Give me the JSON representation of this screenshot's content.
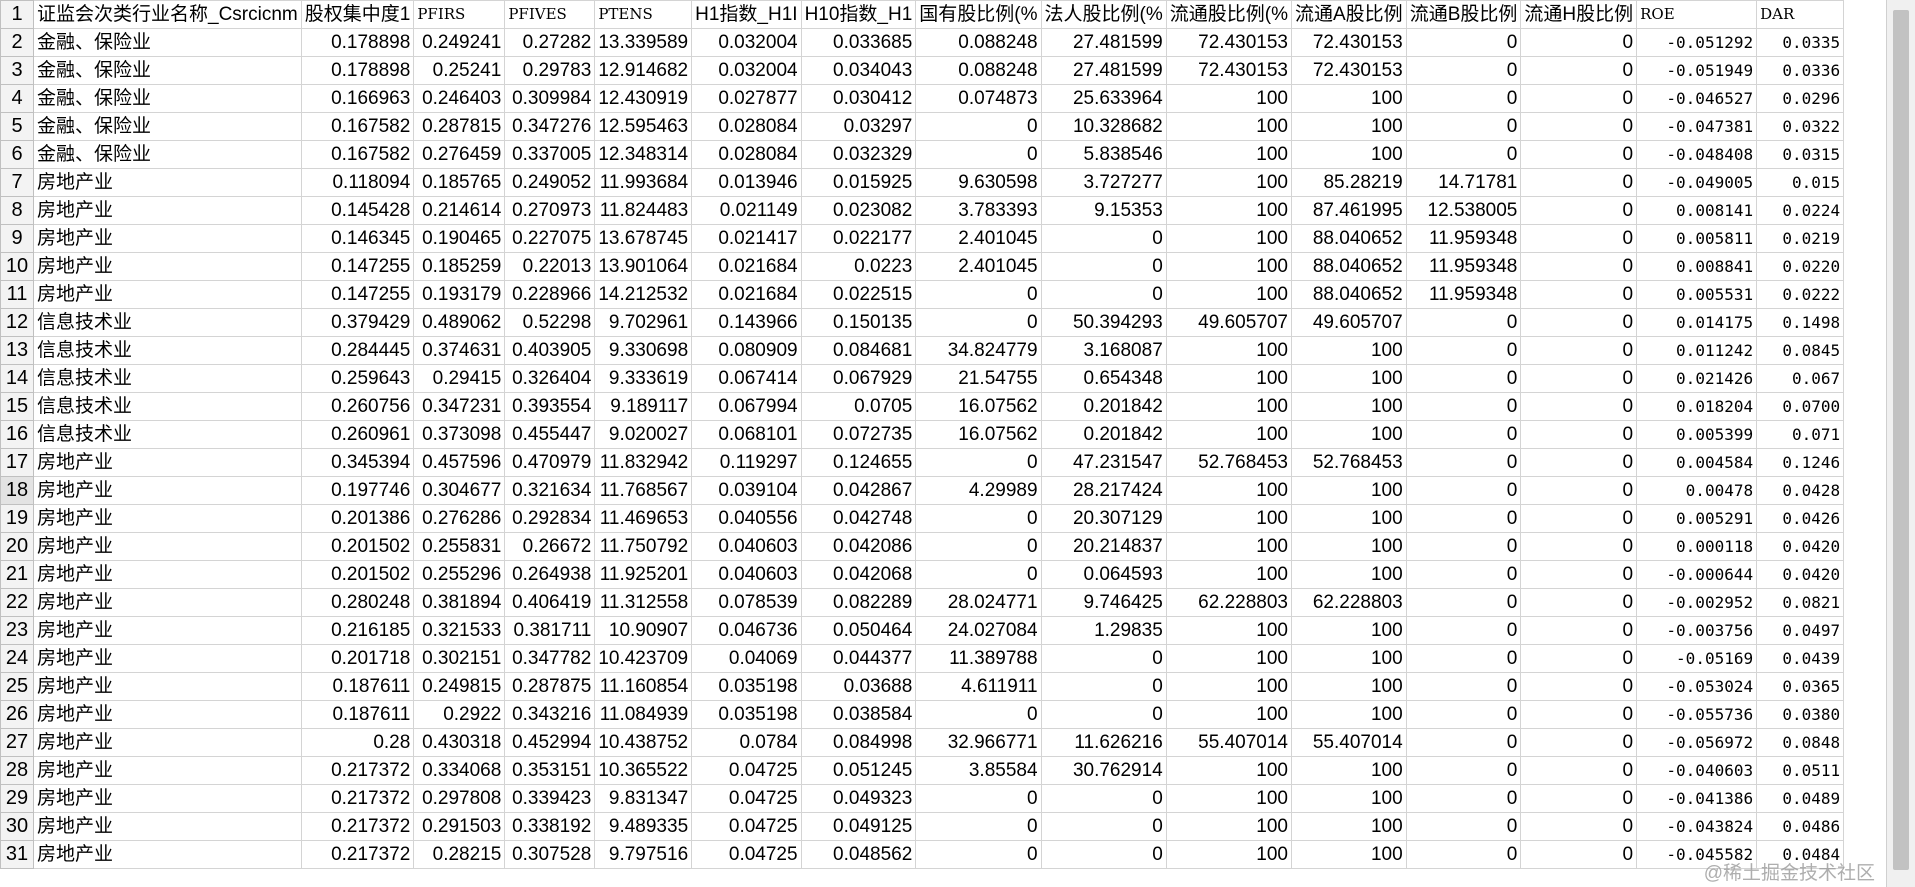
{
  "sheet": {
    "headers": [
      "证监会次类行业名称_Csrcicnm",
      "股权集中度1",
      "PFIRS",
      "PFIVES",
      "PTENS",
      "H1指数_H1I",
      "H10指数_H1",
      "国有股比例(%",
      "法人股比例(%",
      "流通股比例(%",
      "流通A股比例",
      "流通B股比例",
      "流通H股比例",
      "ROE",
      "DAR"
    ],
    "rows": [
      {
        "n": "2",
        "c": [
          "金融、保险业",
          "0.178898",
          "0.249241",
          "0.27282",
          "13.339589",
          "0.032004",
          "0.033685",
          "0.088248",
          "27.481599",
          "72.430153",
          "72.430153",
          "0",
          "0",
          "-0.051292",
          "0.0335"
        ]
      },
      {
        "n": "3",
        "c": [
          "金融、保险业",
          "0.178898",
          "0.25241",
          "0.29783",
          "12.914682",
          "0.032004",
          "0.034043",
          "0.088248",
          "27.481599",
          "72.430153",
          "72.430153",
          "0",
          "0",
          "-0.051949",
          "0.0336"
        ]
      },
      {
        "n": "4",
        "c": [
          "金融、保险业",
          "0.166963",
          "0.246403",
          "0.309984",
          "12.430919",
          "0.027877",
          "0.030412",
          "0.074873",
          "25.633964",
          "100",
          "100",
          "0",
          "0",
          "-0.046527",
          "0.0296"
        ]
      },
      {
        "n": "5",
        "c": [
          "金融、保险业",
          "0.167582",
          "0.287815",
          "0.347276",
          "12.595463",
          "0.028084",
          "0.03297",
          "0",
          "10.328682",
          "100",
          "100",
          "0",
          "0",
          "-0.047381",
          "0.0322"
        ]
      },
      {
        "n": "6",
        "c": [
          "金融、保险业",
          "0.167582",
          "0.276459",
          "0.337005",
          "12.348314",
          "0.028084",
          "0.032329",
          "0",
          "5.838546",
          "100",
          "100",
          "0",
          "0",
          "-0.048408",
          "0.0315"
        ]
      },
      {
        "n": "7",
        "c": [
          "房地产业",
          "0.118094",
          "0.185765",
          "0.249052",
          "11.993684",
          "0.013946",
          "0.015925",
          "9.630598",
          "3.727277",
          "100",
          "85.28219",
          "14.71781",
          "0",
          "-0.049005",
          "0.015"
        ]
      },
      {
        "n": "8",
        "c": [
          "房地产业",
          "0.145428",
          "0.214614",
          "0.270973",
          "11.824483",
          "0.021149",
          "0.023082",
          "3.783393",
          "9.15353",
          "100",
          "87.461995",
          "12.538005",
          "0",
          "0.008141",
          "0.0224"
        ]
      },
      {
        "n": "9",
        "c": [
          "房地产业",
          "0.146345",
          "0.190465",
          "0.227075",
          "13.678745",
          "0.021417",
          "0.022177",
          "2.401045",
          "0",
          "100",
          "88.040652",
          "11.959348",
          "0",
          "0.005811",
          "0.0219"
        ]
      },
      {
        "n": "10",
        "c": [
          "房地产业",
          "0.147255",
          "0.185259",
          "0.22013",
          "13.901064",
          "0.021684",
          "0.0223",
          "2.401045",
          "0",
          "100",
          "88.040652",
          "11.959348",
          "0",
          "0.008841",
          "0.0220"
        ]
      },
      {
        "n": "11",
        "c": [
          "房地产业",
          "0.147255",
          "0.193179",
          "0.228966",
          "14.212532",
          "0.021684",
          "0.022515",
          "0",
          "0",
          "100",
          "88.040652",
          "11.959348",
          "0",
          "0.005531",
          "0.0222"
        ]
      },
      {
        "n": "12",
        "c": [
          "信息技术业",
          "0.379429",
          "0.489062",
          "0.52298",
          "9.702961",
          "0.143966",
          "0.150135",
          "0",
          "50.394293",
          "49.605707",
          "49.605707",
          "0",
          "0",
          "0.014175",
          "0.1498"
        ]
      },
      {
        "n": "13",
        "c": [
          "信息技术业",
          "0.284445",
          "0.374631",
          "0.403905",
          "9.330698",
          "0.080909",
          "0.084681",
          "34.824779",
          "3.168087",
          "100",
          "100",
          "0",
          "0",
          "0.011242",
          "0.0845"
        ]
      },
      {
        "n": "14",
        "c": [
          "信息技术业",
          "0.259643",
          "0.29415",
          "0.326404",
          "9.333619",
          "0.067414",
          "0.067929",
          "21.54755",
          "0.654348",
          "100",
          "100",
          "0",
          "0",
          "0.021426",
          "0.067"
        ]
      },
      {
        "n": "15",
        "c": [
          "信息技术业",
          "0.260756",
          "0.347231",
          "0.393554",
          "9.189117",
          "0.067994",
          "0.0705",
          "16.07562",
          "0.201842",
          "100",
          "100",
          "0",
          "0",
          "0.018204",
          "0.0700"
        ]
      },
      {
        "n": "16",
        "c": [
          "信息技术业",
          "0.260961",
          "0.373098",
          "0.455447",
          "9.020027",
          "0.068101",
          "0.072735",
          "16.07562",
          "0.201842",
          "100",
          "100",
          "0",
          "0",
          "0.005399",
          "0.071"
        ]
      },
      {
        "n": "17",
        "c": [
          "房地产业",
          "0.345394",
          "0.457596",
          "0.470979",
          "11.832942",
          "0.119297",
          "0.124655",
          "0",
          "47.231547",
          "52.768453",
          "52.768453",
          "0",
          "0",
          "0.004584",
          "0.1246"
        ]
      },
      {
        "n": "18",
        "c": [
          "房地产业",
          "0.197746",
          "0.304677",
          "0.321634",
          "11.768567",
          "0.039104",
          "0.042867",
          "4.29989",
          "28.217424",
          "100",
          "100",
          "0",
          "0",
          "0.00478",
          "0.0428"
        ]
      },
      {
        "n": "19",
        "c": [
          "房地产业",
          "0.201386",
          "0.276286",
          "0.292834",
          "11.469653",
          "0.040556",
          "0.042748",
          "0",
          "20.307129",
          "100",
          "100",
          "0",
          "0",
          "0.005291",
          "0.0426"
        ]
      },
      {
        "n": "20",
        "c": [
          "房地产业",
          "0.201502",
          "0.255831",
          "0.26672",
          "11.750792",
          "0.040603",
          "0.042086",
          "0",
          "20.214837",
          "100",
          "100",
          "0",
          "0",
          "0.000118",
          "0.0420"
        ]
      },
      {
        "n": "21",
        "c": [
          "房地产业",
          "0.201502",
          "0.255296",
          "0.264938",
          "11.925201",
          "0.040603",
          "0.042068",
          "0",
          "0.064593",
          "100",
          "100",
          "0",
          "0",
          "-0.000644",
          "0.0420"
        ]
      },
      {
        "n": "22",
        "c": [
          "房地产业",
          "0.280248",
          "0.381894",
          "0.406419",
          "11.312558",
          "0.078539",
          "0.082289",
          "28.024771",
          "9.746425",
          "62.228803",
          "62.228803",
          "0",
          "0",
          "-0.002952",
          "0.0821"
        ]
      },
      {
        "n": "23",
        "c": [
          "房地产业",
          "0.216185",
          "0.321533",
          "0.381711",
          "10.90907",
          "0.046736",
          "0.050464",
          "24.027084",
          "1.29835",
          "100",
          "100",
          "0",
          "0",
          "-0.003756",
          "0.0497"
        ]
      },
      {
        "n": "24",
        "c": [
          "房地产业",
          "0.201718",
          "0.302151",
          "0.347782",
          "10.423709",
          "0.04069",
          "0.044377",
          "11.389788",
          "0",
          "100",
          "100",
          "0",
          "0",
          "-0.05169",
          "0.0439"
        ]
      },
      {
        "n": "25",
        "c": [
          "房地产业",
          "0.187611",
          "0.249815",
          "0.287875",
          "11.160854",
          "0.035198",
          "0.03688",
          "4.611911",
          "0",
          "100",
          "100",
          "0",
          "0",
          "-0.053024",
          "0.0365"
        ]
      },
      {
        "n": "26",
        "c": [
          "房地产业",
          "0.187611",
          "0.2922",
          "0.343216",
          "11.084939",
          "0.035198",
          "0.038584",
          "0",
          "0",
          "100",
          "100",
          "0",
          "0",
          "-0.055736",
          "0.0380"
        ]
      },
      {
        "n": "27",
        "c": [
          "房地产业",
          "0.28",
          "0.430318",
          "0.452994",
          "10.438752",
          "0.0784",
          "0.084998",
          "32.966771",
          "11.626216",
          "55.407014",
          "55.407014",
          "0",
          "0",
          "-0.056972",
          "0.0848"
        ]
      },
      {
        "n": "28",
        "c": [
          "房地产业",
          "0.217372",
          "0.334068",
          "0.353151",
          "10.365522",
          "0.04725",
          "0.051245",
          "3.85584",
          "30.762914",
          "100",
          "100",
          "0",
          "0",
          "-0.040603",
          "0.0511"
        ]
      },
      {
        "n": "29",
        "c": [
          "房地产业",
          "0.217372",
          "0.297808",
          "0.339423",
          "9.831347",
          "0.04725",
          "0.049323",
          "0",
          "0",
          "100",
          "100",
          "0",
          "0",
          "-0.041386",
          "0.0489"
        ]
      },
      {
        "n": "30",
        "c": [
          "房地产业",
          "0.217372",
          "0.291503",
          "0.338192",
          "9.489335",
          "0.04725",
          "0.049125",
          "0",
          "0",
          "100",
          "100",
          "0",
          "0",
          "-0.043824",
          "0.0486"
        ]
      },
      {
        "n": "31",
        "c": [
          "房地产业",
          "0.217372",
          "0.28215",
          "0.307528",
          "9.797516",
          "0.04725",
          "0.048562",
          "0",
          "0",
          "100",
          "100",
          "0",
          "0",
          "-0.045582",
          "0.0484"
        ]
      }
    ]
  },
  "watermark": "@稀土掘金技术社区"
}
